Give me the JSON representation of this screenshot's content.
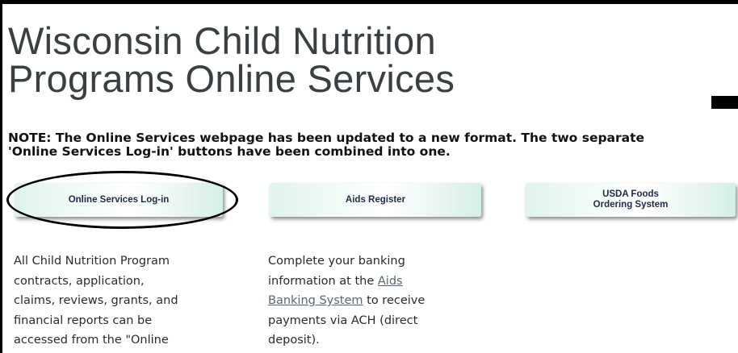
{
  "title_line1": "Wisconsin Child Nutrition",
  "title_line2": "Programs Online Services",
  "note_line1": "NOTE: The Online Services webpage has been updated to a new format. The two separate",
  "note_line2": "'Online Services Log-in' buttons have been combined into one.",
  "buttons": {
    "login": "Online Services Log-in",
    "aids": "Aids Register",
    "usda_line1": "USDA Foods",
    "usda_line2": "Ordering System"
  },
  "col1_lines": [
    "All Child Nutrition Program",
    "contracts, application,",
    "claims, reviews, grants, and",
    "financial reports can be",
    "accessed from the \"Online"
  ],
  "col2": {
    "line1": "Complete your banking",
    "line2_pre": "information at the ",
    "link_part1": "Aids",
    "link_part2": "Banking System",
    "line3_post": " to receive",
    "line4": "payments via ACH (direct",
    "line5": "deposit)."
  },
  "colors": {
    "title": "#3a3f42",
    "button_text": "#1f2a44",
    "button_gradient_edge": "#d3efe4"
  }
}
